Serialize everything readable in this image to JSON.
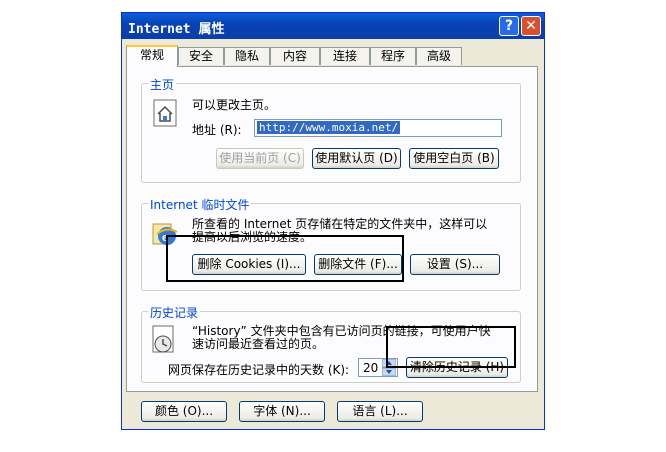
{
  "window": {
    "title": "Internet 属性",
    "help_label": "?",
    "close_label": "✕"
  },
  "tabs": [
    {
      "label": "常规",
      "active": true
    },
    {
      "label": "安全"
    },
    {
      "label": "隐私"
    },
    {
      "label": "内容"
    },
    {
      "label": "连接"
    },
    {
      "label": "程序"
    },
    {
      "label": "高级"
    }
  ],
  "homepage": {
    "group_title": "主页",
    "desc": "可以更改主页。",
    "address_label": "地址 (R):",
    "address_value": "http://www.moxia.net/",
    "use_current": "使用当前页 (C)",
    "use_default": "使用默认页 (D)",
    "use_blank": "使用空白页 (B)"
  },
  "temp_files": {
    "group_title": "Internet 临时文件",
    "desc_line1": "所查看的 Internet 页存储在特定的文件夹中，这样可以",
    "desc_line2": "提高以后浏览的速度。",
    "delete_cookies": "删除 Cookies (I)...",
    "delete_files": "删除文件 (F)...",
    "settings": "设置 (S)..."
  },
  "history": {
    "group_title": "历史记录",
    "desc_line1": "“History” 文件夹中包含有已访问页的链接，可使用户快",
    "desc_line2": "速访问最近查看过的页。",
    "days_label": "网页保存在历史记录中的天数 (K):",
    "days_value": "20",
    "clear": "清除历史记录 (H)"
  },
  "bottom": {
    "colors": "颜色 (O)...",
    "fonts": "字体 (N)...",
    "languages": "语言 (L)..."
  },
  "colors": {
    "titlebar": "#0842b8",
    "selection": "#316ac5",
    "group_title": "#0046d5"
  }
}
